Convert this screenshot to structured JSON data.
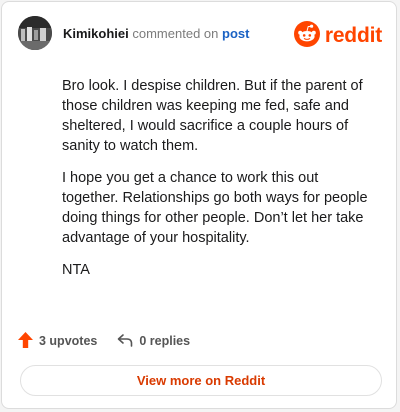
{
  "header": {
    "username": "Kimikohiei",
    "commented_text": "commented on",
    "post_link": "post",
    "brand_name": "reddit",
    "brand_color": "#ff4500"
  },
  "comment": {
    "paragraphs": [
      "Bro look. I despise children. But if the parent of those children was keeping me fed, safe and sheltered, I would sacrifice a couple hours of sanity to watch them.",
      "I hope you get a chance to work this out together. Relationships go both ways for people doing things for other people. Don’t let her take advantage of your hospitality.",
      "NTA"
    ]
  },
  "actions": {
    "upvotes": "3 upvotes",
    "replies": "0 replies",
    "upvote_icon": "upvote-arrow-icon",
    "reply_icon": "reply-icon"
  },
  "footer": {
    "view_more": "View more on Reddit"
  }
}
